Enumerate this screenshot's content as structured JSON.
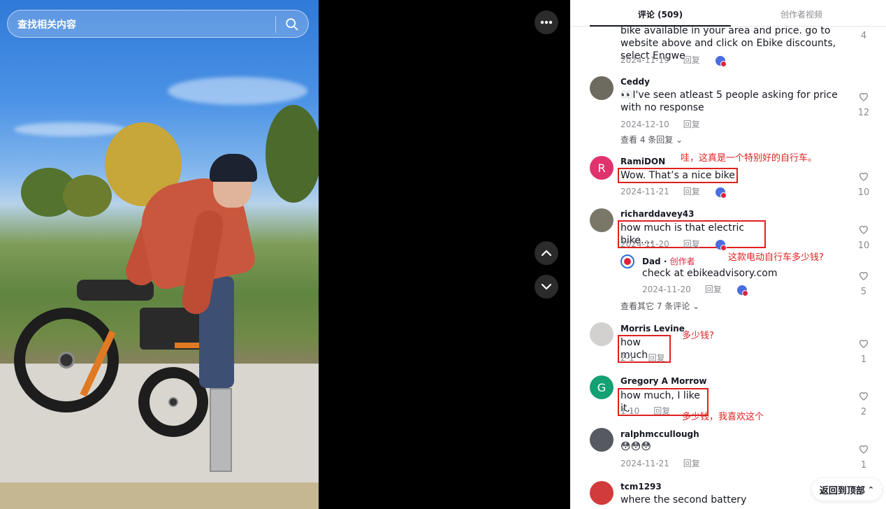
{
  "search": {
    "placeholder": "查找相关内容"
  },
  "tabs": {
    "comments": "评论 (509)",
    "creator_videos": "创作者视频"
  },
  "comments": [
    {
      "username": "",
      "text": "bike available in your area and price. go to website above and click on Ebike discounts, select Engwe",
      "date": "2024-11-19",
      "reply": "回复",
      "likes": "4"
    },
    {
      "username": "Ceddy",
      "text": "👀I've seen atleast 5 people asking for price with no response",
      "date": "2024-12-10",
      "reply": "回复",
      "likes": "12",
      "more": "查看 4 条回复"
    },
    {
      "username": "RamiDON",
      "avatar_letter": "R",
      "text": "Wow. That’s a nice bike",
      "date": "2024-11-21",
      "reply": "回复",
      "likes": "10",
      "annotation": "哇，这真是一个特别好的自行车。"
    },
    {
      "username": "richarddavey43",
      "text": "how much is that electric bike....",
      "date": "2024-11-20",
      "reply": "回复",
      "likes": "10",
      "annotation": "这款电动自行车多少钱?",
      "sub": {
        "username": "Dad",
        "badge": "创作者",
        "text": "check at ebikeadvisory.com",
        "date": "2024-11-20",
        "reply": "回复",
        "likes": "5"
      },
      "more": "查看其它 7 条评论"
    },
    {
      "username": "Morris Levine",
      "text": "how much",
      "date": "2-1",
      "reply": "回复",
      "likes": "1",
      "annotation": "多少钱?"
    },
    {
      "username": "Gregory A Morrow",
      "avatar_letter": "G",
      "text": "how much, I like it,,",
      "date": "1-10",
      "reply": "回复",
      "likes": "2",
      "annotation": "多少钱，我喜欢这个"
    },
    {
      "username": "ralphmccullough",
      "text": "😳😳😳",
      "date": "2024-11-21",
      "reply": "回复",
      "likes": "1"
    },
    {
      "username": "tcm1293",
      "text": "where the second battery"
    }
  ],
  "back_to_top": "返回到顶部",
  "colors": {
    "annotation": "#e02020",
    "rami_avatar": "#e0336e",
    "gregory_avatar": "#14a072"
  }
}
